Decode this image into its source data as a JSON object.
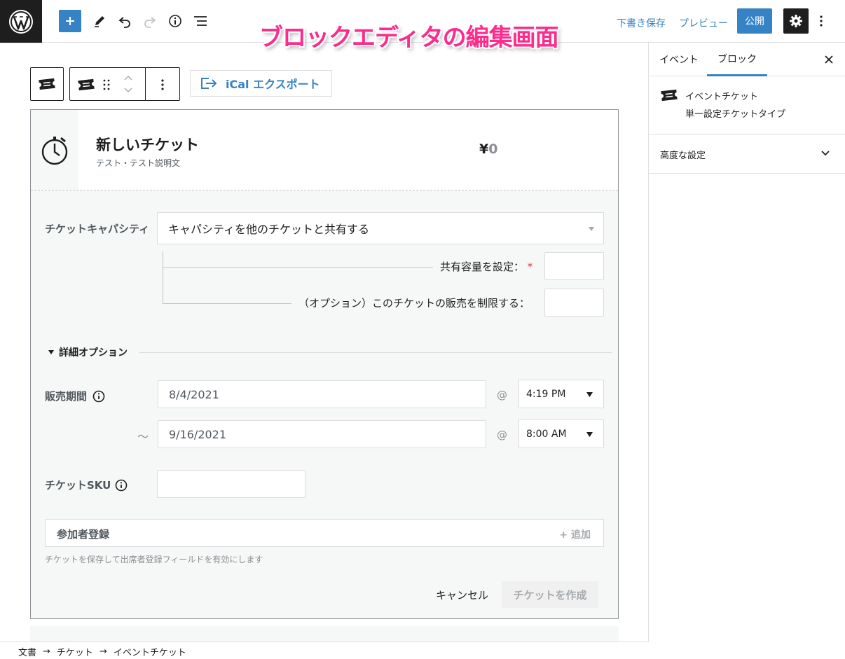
{
  "topbar": {
    "overlay_title": "ブロックエディタの編集画面",
    "save_draft": "下書き保存",
    "preview": "プレビュー",
    "publish": "公開"
  },
  "sidebar": {
    "tabs": [
      {
        "label": "イベント"
      },
      {
        "label": "ブロック"
      }
    ],
    "block_card": {
      "title": "イベントチケット",
      "description": "単一設定チケットタイプ"
    },
    "advanced": "高度な設定"
  },
  "editor": {
    "ical_export": "iCal エクスポート",
    "ticket": {
      "name": "新しいチケット",
      "description": "テスト・テスト説明文",
      "currency": "¥",
      "price": "0"
    },
    "capacity": {
      "label": "チケットキャパシティ",
      "selected": "キャパシティを他のチケットと共有する",
      "shared_label": "共有容量を設定：",
      "required_mark": "*",
      "limit_label": "（オプション）このチケットの販売を制限する："
    },
    "advanced_options": "詳細オプション",
    "sale_period": {
      "label": "販売期間",
      "start_date": "8/4/2021",
      "start_time": "4:19 PM",
      "end_date": "9/16/2021",
      "end_time": "8:00 AM",
      "tilde": "〜",
      "at": "@"
    },
    "sku": {
      "label": "チケットSKU",
      "value": ""
    },
    "attendee": {
      "label": "参加者登録",
      "add": "+ 追加",
      "help": "チケットを保存して出席者登録フィールドを有効にします"
    },
    "buttons": {
      "cancel": "キャンセル",
      "create": "チケットを作成"
    }
  },
  "breadcrumb": [
    "文書",
    "チケット",
    "イベントチケット"
  ],
  "colors": {
    "accent": "#3582c4",
    "overlay": "#ff2a8c",
    "dark": "#1e1e1e"
  }
}
